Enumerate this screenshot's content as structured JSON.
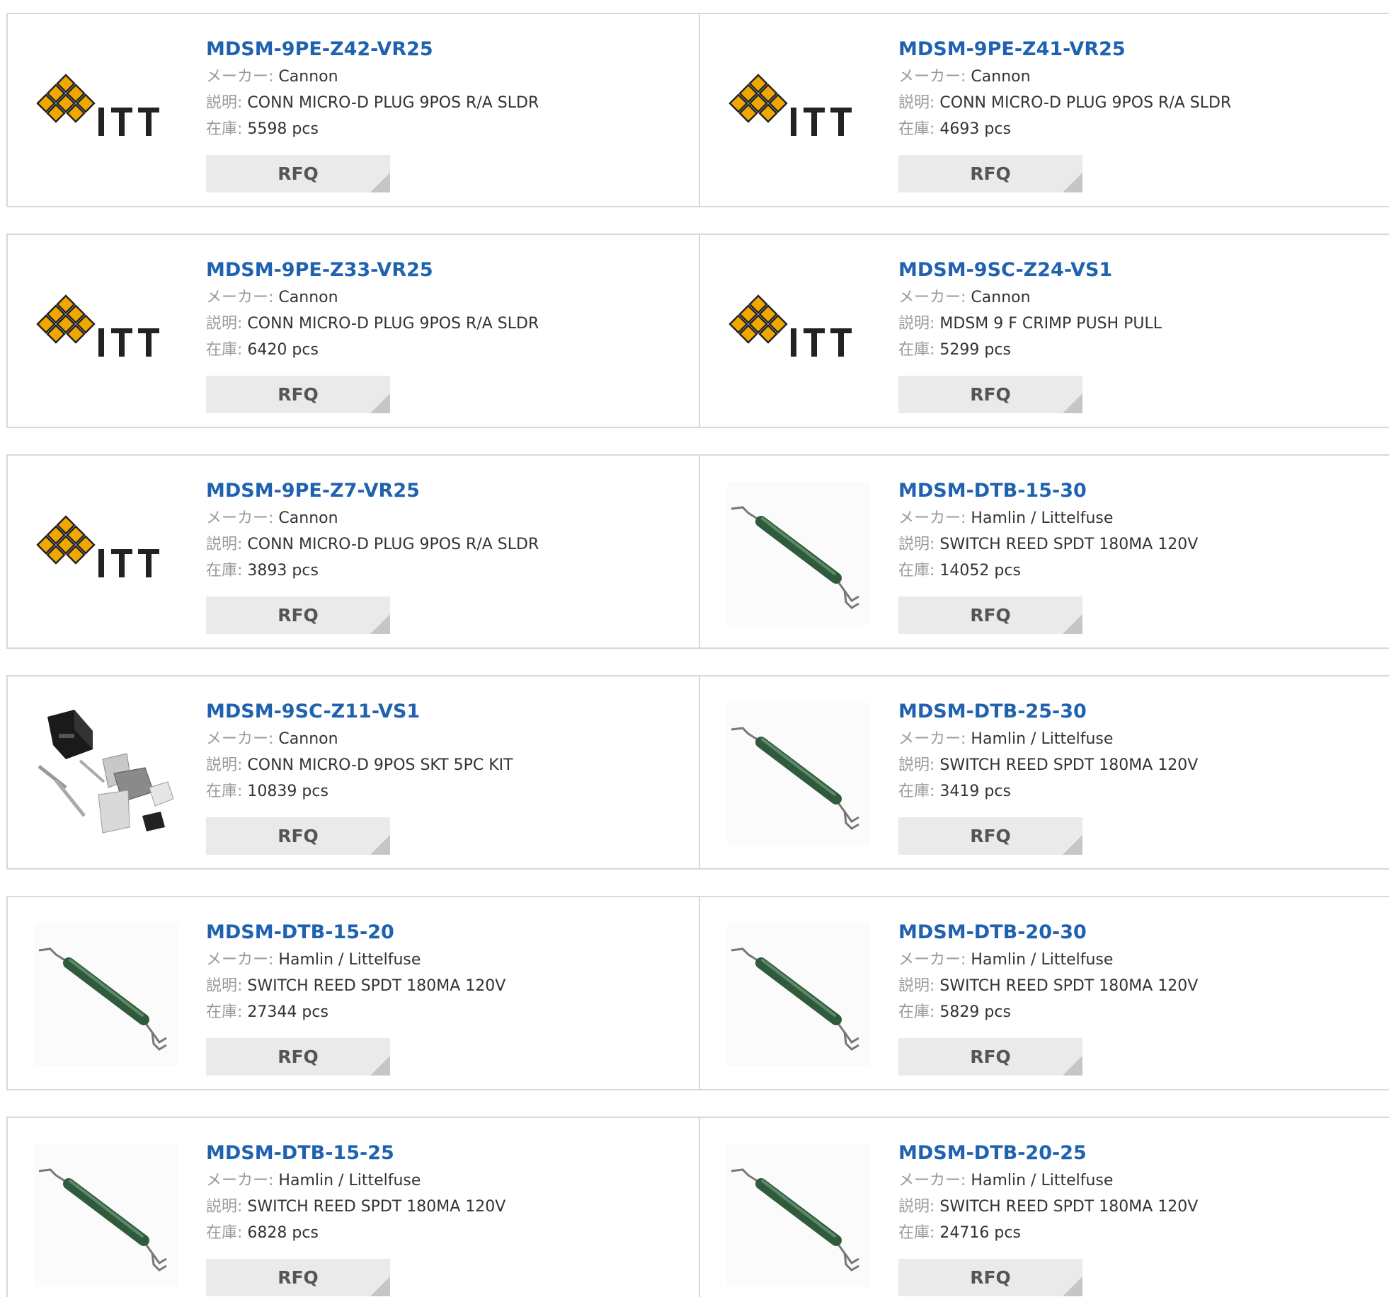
{
  "labels": {
    "maker": "メーカー:",
    "desc": "説明:",
    "stock": "在庫:",
    "rfq": "RFQ"
  },
  "products": [
    {
      "pn": "MDSM-9PE-Z42-VR25",
      "maker": "Cannon",
      "desc": "CONN MICRO-D PLUG 9POS R/A SLDR",
      "stock": "5598 pcs",
      "image": "itt-logo"
    },
    {
      "pn": "MDSM-9PE-Z41-VR25",
      "maker": "Cannon",
      "desc": "CONN MICRO-D PLUG 9POS R/A SLDR",
      "stock": "4693 pcs",
      "image": "itt-logo"
    },
    {
      "pn": "MDSM-9PE-Z33-VR25",
      "maker": "Cannon",
      "desc": "CONN MICRO-D PLUG 9POS R/A SLDR",
      "stock": "6420 pcs",
      "image": "itt-logo"
    },
    {
      "pn": "MDSM-9SC-Z24-VS1",
      "maker": "Cannon",
      "desc": "MDSM 9 F CRIMP PUSH PULL",
      "stock": "5299 pcs",
      "image": "itt-logo"
    },
    {
      "pn": "MDSM-9PE-Z7-VR25",
      "maker": "Cannon",
      "desc": "CONN MICRO-D PLUG 9POS R/A SLDR",
      "stock": "3893 pcs",
      "image": "itt-logo"
    },
    {
      "pn": "MDSM-DTB-15-30",
      "maker": "Hamlin / Littelfuse",
      "desc": "SWITCH REED SPDT 180MA 120V",
      "stock": "14052 pcs",
      "image": "reed-switch"
    },
    {
      "pn": "MDSM-9SC-Z11-VS1",
      "maker": "Cannon",
      "desc": "CONN MICRO-D 9POS SKT 5PC KIT",
      "stock": "10839 pcs",
      "image": "connector-kit"
    },
    {
      "pn": "MDSM-DTB-25-30",
      "maker": "Hamlin / Littelfuse",
      "desc": "SWITCH REED SPDT 180MA 120V",
      "stock": "3419 pcs",
      "image": "reed-switch"
    },
    {
      "pn": "MDSM-DTB-15-20",
      "maker": "Hamlin / Littelfuse",
      "desc": "SWITCH REED SPDT 180MA 120V",
      "stock": "27344 pcs",
      "image": "reed-switch"
    },
    {
      "pn": "MDSM-DTB-20-30",
      "maker": "Hamlin / Littelfuse",
      "desc": "SWITCH REED SPDT 180MA 120V",
      "stock": "5829 pcs",
      "image": "reed-switch"
    },
    {
      "pn": "MDSM-DTB-15-25",
      "maker": "Hamlin / Littelfuse",
      "desc": "SWITCH REED SPDT 180MA 120V",
      "stock": "6828 pcs",
      "image": "reed-switch"
    },
    {
      "pn": "MDSM-DTB-20-25",
      "maker": "Hamlin / Littelfuse",
      "desc": "SWITCH REED SPDT 180MA 120V",
      "stock": "24716 pcs",
      "image": "reed-switch"
    }
  ],
  "colors": {
    "part_number": "#1f62b0",
    "label": "#9a9a9a",
    "value": "#333333",
    "rfq_bg": "#eaeaea",
    "border": "#d8d8d8",
    "itt_gold": "#f0a800"
  }
}
